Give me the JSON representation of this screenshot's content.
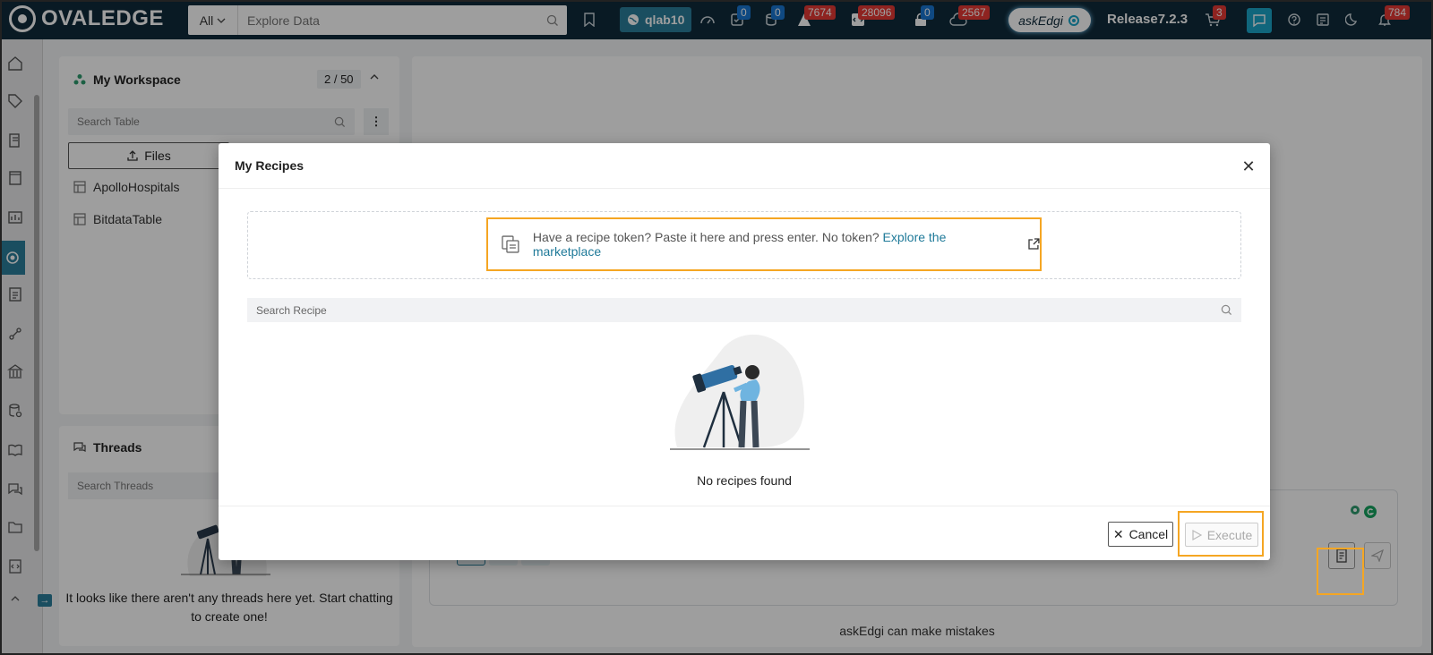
{
  "app": {
    "brand": "OVALEDGE"
  },
  "header": {
    "search_scope": "All",
    "search_placeholder": "Explore Data",
    "workspace_chip": "qlab10",
    "badges": {
      "queries": "0",
      "database": "0",
      "alerts": "7674",
      "code": "28096",
      "lock": "0",
      "api": "2567",
      "cart": "3",
      "notifications": "784"
    },
    "askedgi_label": "askEdgi",
    "release": "Release7.2.3"
  },
  "workspace": {
    "title": "My Workspace",
    "count": "2 / 50",
    "search_placeholder": "Search Table",
    "files_label": "Files",
    "items": [
      {
        "label": "ApolloHospitals"
      },
      {
        "label": "BitdataTable"
      }
    ]
  },
  "threads": {
    "title": "Threads",
    "search_placeholder": "Search Threads",
    "empty_text": "It looks like there aren't any threads here yet. Start chatting to create one!"
  },
  "main": {
    "disclaimer": "askEdgi can make mistakes"
  },
  "modal": {
    "title": "My Recipes",
    "token_prompt": "Have a recipe token? Paste it here and press enter. No token?",
    "token_link": "Explore the marketplace",
    "search_placeholder": "Search Recipe",
    "empty_text": "No recipes found",
    "cancel_label": "Cancel",
    "execute_label": "Execute"
  },
  "colors": {
    "topbar": "#0f2a3a",
    "accent": "#2a7f9c",
    "highlight": "#f5a623",
    "badge_red": "#e53935",
    "badge_blue": "#1976d2"
  }
}
